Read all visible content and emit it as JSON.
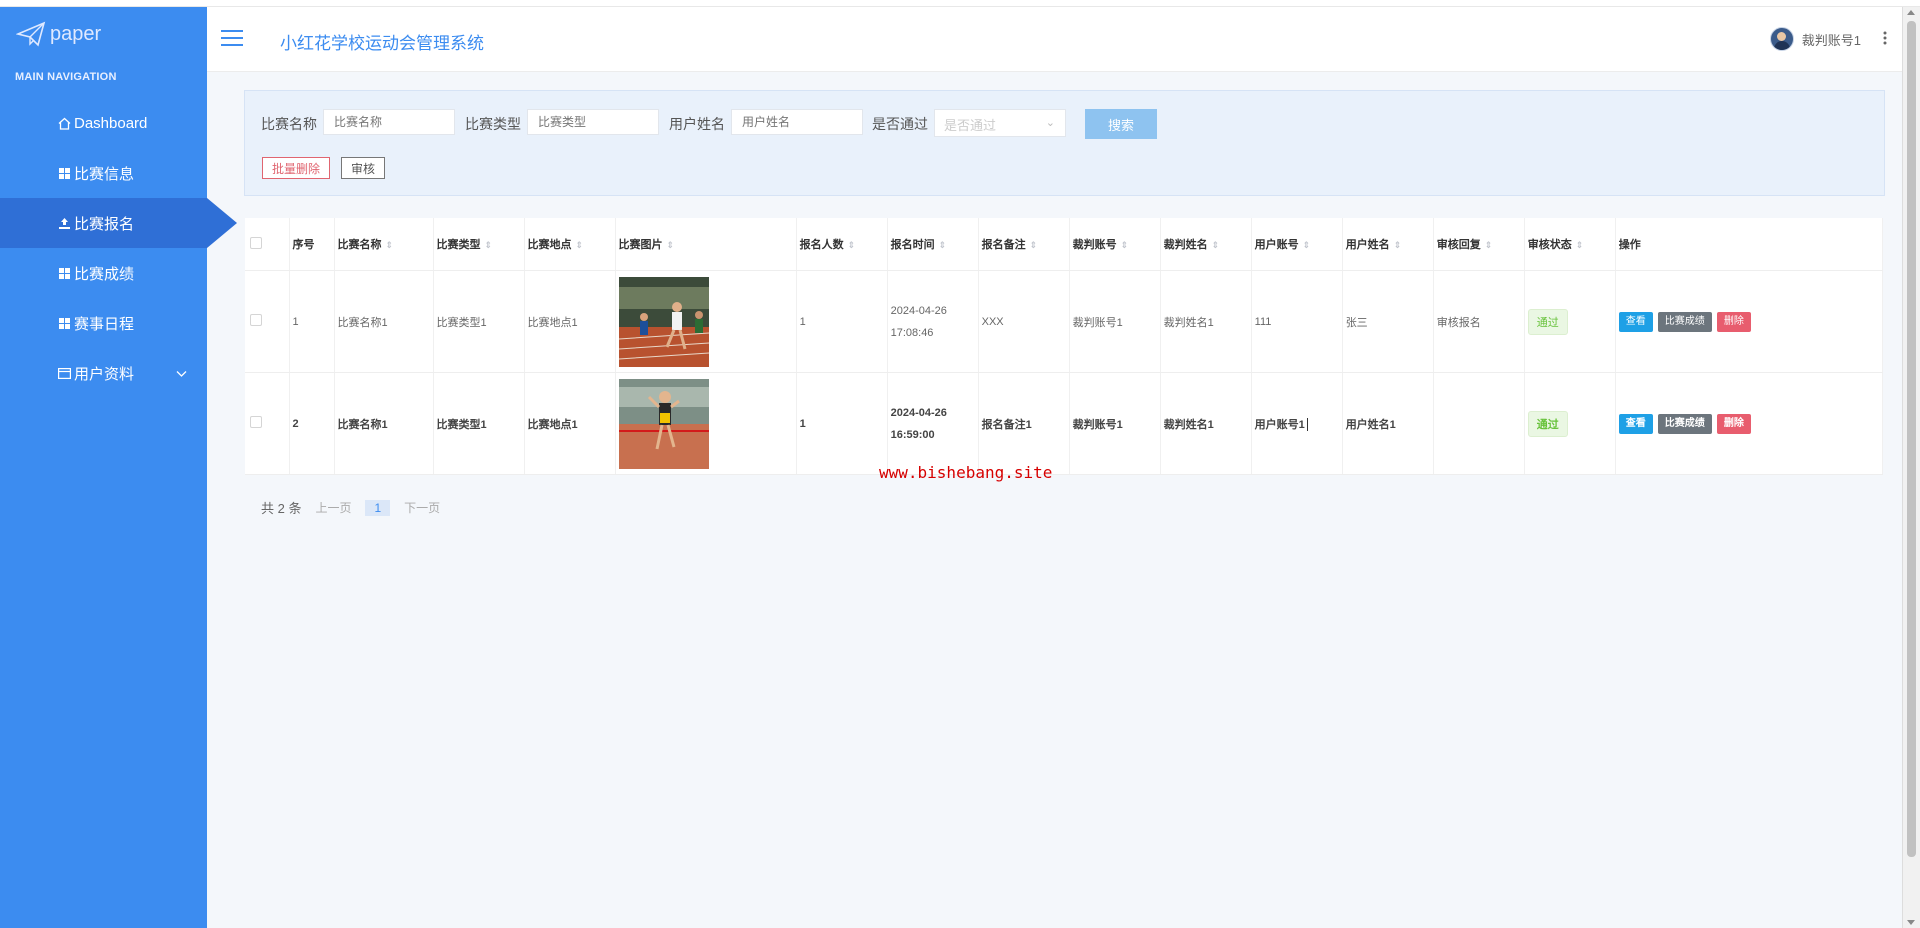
{
  "sidebar": {
    "logo_text": "paper",
    "nav_heading": "MAIN NAVIGATION",
    "items": [
      {
        "label": "Dashboard",
        "icon": "home-icon"
      },
      {
        "label": "比赛信息",
        "icon": "grid-icon"
      },
      {
        "label": "比赛报名",
        "icon": "upload-icon",
        "active": true
      },
      {
        "label": "比赛成绩",
        "icon": "grid-icon"
      },
      {
        "label": "赛事日程",
        "icon": "grid-icon"
      },
      {
        "label": "用户资料",
        "icon": "id-card-icon",
        "expandable": true
      }
    ]
  },
  "header": {
    "title": "小红花学校运动会管理系统",
    "username": "裁判账号1"
  },
  "search": {
    "fields": [
      {
        "label": "比赛名称",
        "placeholder": "比赛名称"
      },
      {
        "label": "比赛类型",
        "placeholder": "比赛类型"
      },
      {
        "label": "用户姓名",
        "placeholder": "用户姓名"
      }
    ],
    "select": {
      "label": "是否通过",
      "placeholder": "是否通过"
    },
    "search_button": "搜索",
    "batch_delete": "批量删除",
    "audit_button": "审核"
  },
  "table": {
    "columns": [
      "序号",
      "比赛名称",
      "比赛类型",
      "比赛地点",
      "比赛图片",
      "报名人数",
      "报名时间",
      "报名备注",
      "裁判账号",
      "裁判姓名",
      "用户账号",
      "用户姓名",
      "审核回复",
      "审核状态",
      "操作"
    ],
    "rows": [
      {
        "no": "1",
        "name": "比赛名称1",
        "type": "比赛类型1",
        "place": "比赛地点1",
        "count": "1",
        "time": "2024-04-26 17:08:46",
        "remark": "XXX",
        "ref_account": "裁判账号1",
        "ref_name": "裁判姓名1",
        "user_account": "111",
        "user_name": "张三",
        "reply": "审核报名",
        "status": "通过"
      },
      {
        "no": "2",
        "name": "比赛名称1",
        "type": "比赛类型1",
        "place": "比赛地点1",
        "count": "1",
        "time": "2024-04-26 16:59:00",
        "remark": "报名备注1",
        "ref_account": "裁判账号1",
        "ref_name": "裁判姓名1",
        "user_account": "用户账号1",
        "user_name": "用户姓名1",
        "reply": "",
        "status": "通过"
      }
    ],
    "actions": {
      "view": "查看",
      "score": "比赛成绩",
      "delete": "删除"
    }
  },
  "watermark": "www.bishebang.site",
  "pager": {
    "total": "共 2 条",
    "prev": "上一页",
    "current": "1",
    "next": "下一页"
  }
}
